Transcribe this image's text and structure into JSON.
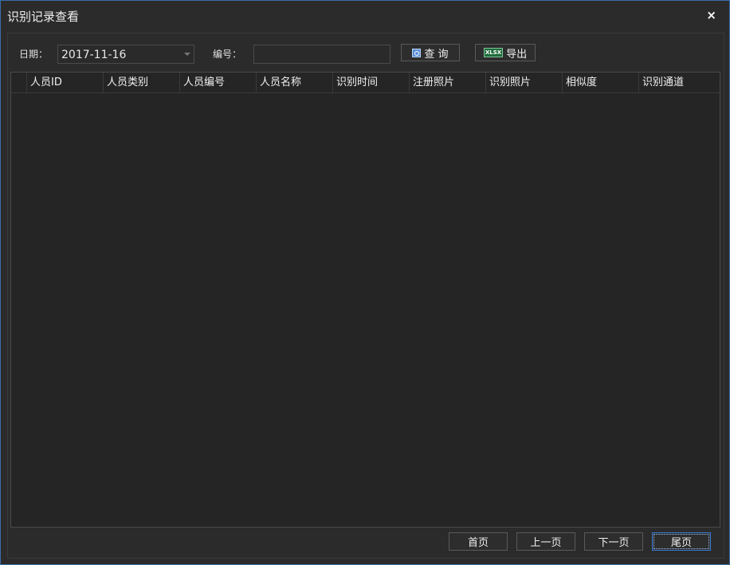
{
  "window": {
    "title": "识别记录查看",
    "close_label": "×"
  },
  "filters": {
    "date_label": "日期：",
    "date_value": "2017-11-16",
    "number_label": "编号：",
    "number_value": "",
    "search_label": "查 询",
    "export_label": "导出",
    "export_icon_text": "XLSX"
  },
  "table": {
    "columns": [
      "人员ID",
      "人员类别",
      "人员编号",
      "人员名称",
      "识别时间",
      "注册照片",
      "识别照片",
      "相似度",
      "识别通道"
    ],
    "rows": []
  },
  "pager": {
    "first": "首页",
    "prev": "上一页",
    "next": "下一页",
    "last": "尾页"
  },
  "colors": {
    "border_accent": "#3a6ea5",
    "background": "#2b2b2b",
    "grid_background": "#252525"
  }
}
